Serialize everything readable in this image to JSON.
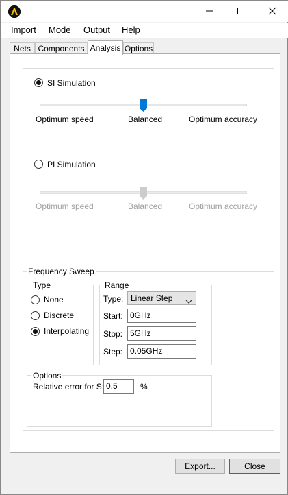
{
  "window": {
    "title": "",
    "app_icon": "app-logo-icon",
    "controls": [
      "minimize-icon",
      "maximize-icon",
      "close-icon"
    ]
  },
  "menu": [
    "Import",
    "Mode",
    "Output",
    "Help"
  ],
  "tabs": [
    {
      "label": "Nets",
      "active": false
    },
    {
      "label": "Components",
      "active": false
    },
    {
      "label": "Analysis",
      "active": true
    },
    {
      "label": "Options",
      "active": false
    }
  ],
  "si": {
    "label": "SI Simulation",
    "checked": true,
    "slider_left": "Optimum speed",
    "slider_mid": "Balanced",
    "slider_right": "Optimum accuracy",
    "slider_level": "Balanced",
    "accent": "#0078d7"
  },
  "pi": {
    "label": "PI Simulation",
    "checked": false,
    "slider_left": "Optimum speed",
    "slider_mid": "Balanced",
    "slider_right": "Optimum accuracy",
    "slider_level": "Balanced",
    "enabled": false
  },
  "sweep": {
    "title": "Frequency Sweep",
    "type_group": {
      "title": "Type",
      "options": [
        {
          "label": "None",
          "checked": false
        },
        {
          "label": "Discrete",
          "checked": false
        },
        {
          "label": "Interpolating",
          "checked": true
        }
      ]
    },
    "range_group": {
      "title": "Range",
      "type_label": "Type:",
      "type_value": "Linear Step",
      "start_label": "Start:",
      "start_value": "0GHz",
      "stop_label": "Stop:",
      "stop_value": "5GHz",
      "step_label": "Step:",
      "step_value": "0.05GHz"
    },
    "options_group": {
      "title": "Options",
      "rel_error_label": "Relative error for S:",
      "rel_error_value": "0.5",
      "unit": "%"
    }
  },
  "buttons": {
    "export": "Export...",
    "close": "Close"
  }
}
